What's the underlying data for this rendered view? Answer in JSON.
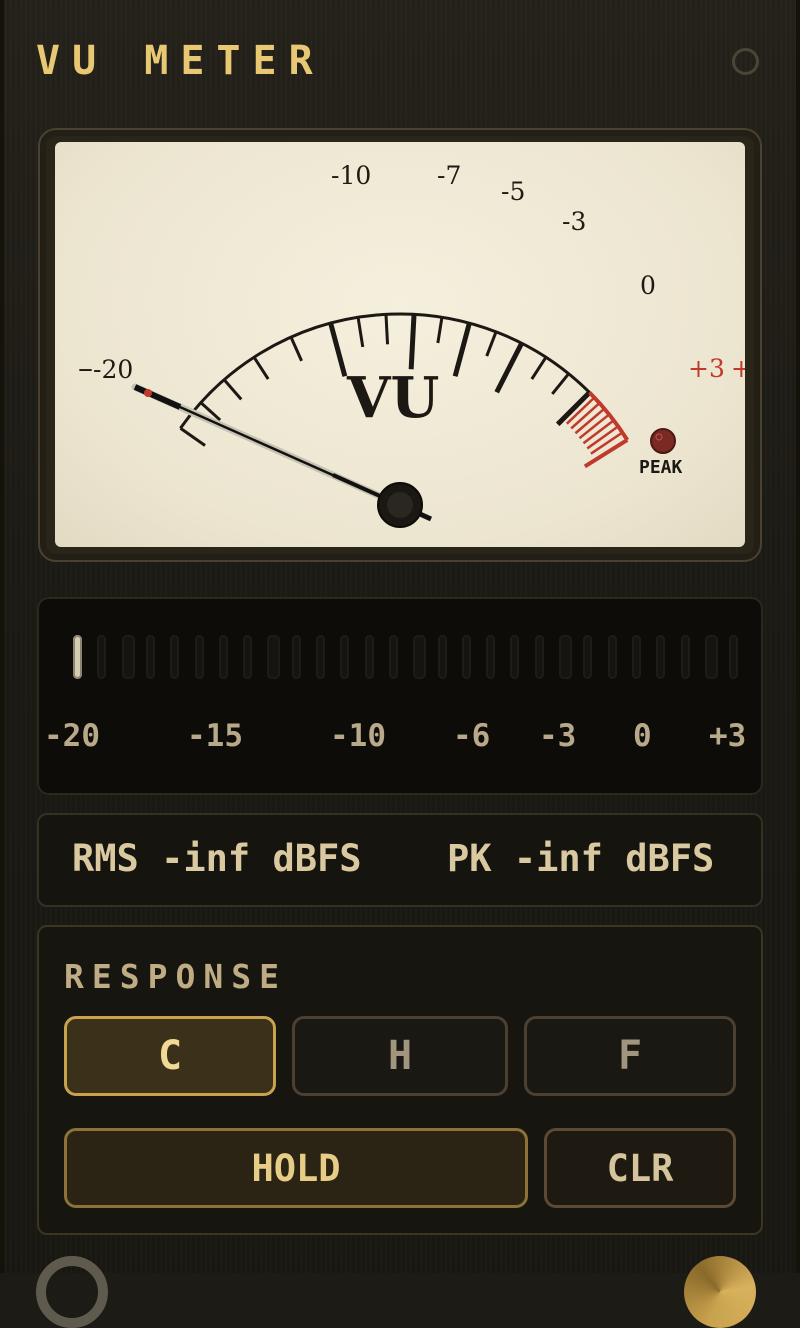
{
  "header": {
    "title": "VU METER",
    "power_icon": "power-ring-icon"
  },
  "meter": {
    "scale_labels": [
      "-20",
      "-10",
      "-7",
      "-5",
      "-3",
      "0",
      "+3"
    ],
    "minus_sign": "–",
    "plus_sign": "+",
    "center_label": "VU",
    "peak_label": "PEAK",
    "needle_value_vu": -20,
    "colors": {
      "face": "#efe8d4",
      "ink": "#1c1813",
      "red_zone": "#c0392b",
      "peak_led": "#7a2a22"
    }
  },
  "bargraph": {
    "segments_total": 28,
    "segments_lit": 1,
    "labels": [
      "-20",
      "-15",
      "-10",
      "-6",
      "-3",
      "0",
      "+3"
    ]
  },
  "readout": {
    "rms": "RMS -inf dBFS",
    "pk": "PK -inf dBFS"
  },
  "response": {
    "title": "RESPONSE",
    "modes": [
      {
        "label": "C",
        "active": true
      },
      {
        "label": "H",
        "active": false
      },
      {
        "label": "F",
        "active": false
      }
    ],
    "hold_label": "HOLD",
    "clear_label": "CLR"
  },
  "accent_color": "#c9a24e"
}
